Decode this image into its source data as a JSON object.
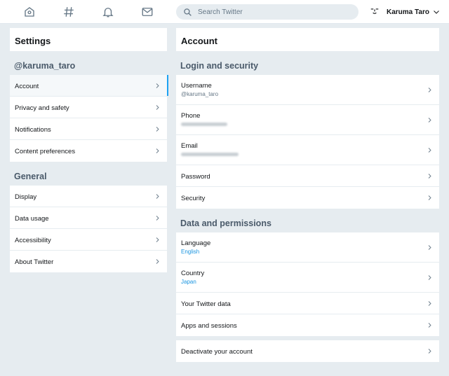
{
  "nav": {
    "home_icon": "home-icon",
    "explore_icon": "hashtag-icon",
    "notifications_icon": "bell-icon",
    "messages_icon": "envelope-icon"
  },
  "search": {
    "placeholder": "Search Twitter"
  },
  "account_menu": {
    "name": "Karuma Taro"
  },
  "settings": {
    "title": "Settings",
    "handle": "@karuma_taro",
    "account_items": [
      "Account",
      "Privacy and safety",
      "Notifications",
      "Content preferences"
    ],
    "general_title": "General",
    "general_items": [
      "Display",
      "Data usage",
      "Accessibility",
      "About Twitter"
    ]
  },
  "account": {
    "title": "Account",
    "login_title": "Login and security",
    "username_label": "Username",
    "username_value": "@karuma_taro",
    "phone_label": "Phone",
    "email_label": "Email",
    "password_label": "Password",
    "security_label": "Security",
    "data_title": "Data and permissions",
    "language_label": "Language",
    "language_value": "English",
    "country_label": "Country",
    "country_value": "Japan",
    "twitter_data_label": "Your Twitter data",
    "apps_label": "Apps and sessions",
    "deactivate_label": "Deactivate your account"
  },
  "colors": {
    "accent": "#1da1f2",
    "link": "#1b95e0",
    "background": "#e6ecf0"
  }
}
